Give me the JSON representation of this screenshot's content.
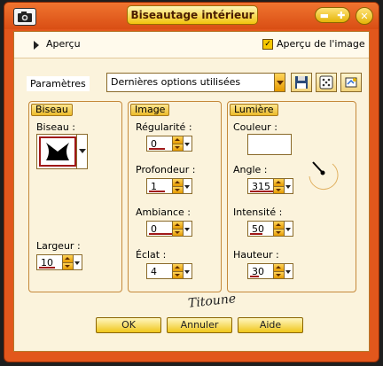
{
  "window": {
    "title": "Biseautage intérieur",
    "colors": {
      "frame": "#e2571c",
      "panel": "#fbf3dc",
      "accent": "#f2c20c",
      "marker": "#a01818"
    }
  },
  "preview": {
    "label": "Aperçu",
    "image_preview_label": "Aperçu de l'image",
    "image_preview_checked": true
  },
  "params": {
    "label": "Paramètres",
    "preset_value": "Dernières options utilisées",
    "icons": [
      "save-icon",
      "random-dice-icon",
      "reset-icon"
    ]
  },
  "biseau": {
    "title": "Biseau",
    "biseau_label": "Biseau :",
    "largeur_label": "Largeur :",
    "largeur_value": "10"
  },
  "image": {
    "title": "Image",
    "regularite_label": "Régularité :",
    "regularite_value": "0",
    "profondeur_label": "Profondeur :",
    "profondeur_value": "1",
    "ambiance_label": "Ambiance :",
    "ambiance_value": "0",
    "eclat_label": "Éclat :",
    "eclat_value": "4"
  },
  "lumiere": {
    "title": "Lumière",
    "couleur_label": "Couleur :",
    "couleur_value": "#ffffff",
    "angle_label": "Angle :",
    "angle_value": "315",
    "intensite_label": "Intensité :",
    "intensite_value": "50",
    "hauteur_label": "Hauteur :",
    "hauteur_value": "30"
  },
  "buttons": {
    "ok": "OK",
    "cancel": "Annuler",
    "help": "Aide"
  },
  "signature": "Titoune"
}
